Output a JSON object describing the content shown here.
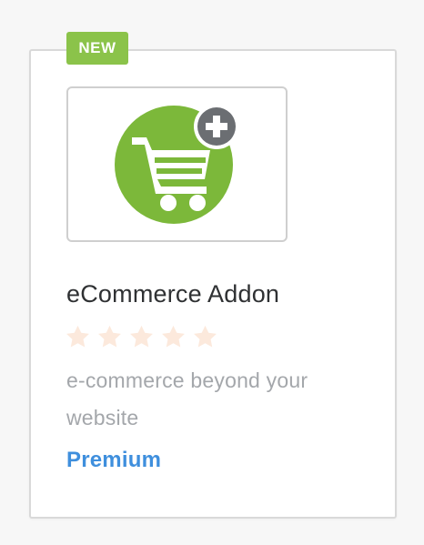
{
  "addon": {
    "badge": "NEW",
    "icon": "shopping-cart-add-icon",
    "title": "eCommerce Addon",
    "rating": {
      "value": 0,
      "max": 5
    },
    "description": "e-commerce beyond your website",
    "tier": "Premium"
  },
  "colors": {
    "badge_bg": "#8bc34a",
    "icon_green": "#7cb83a",
    "plus_gray": "#6b6e72",
    "star_empty": "#fce9dc",
    "title": "#2f3133",
    "description": "#a4a7ab",
    "tier_link": "#3f8fdd",
    "card_border": "#d9d9d9"
  }
}
